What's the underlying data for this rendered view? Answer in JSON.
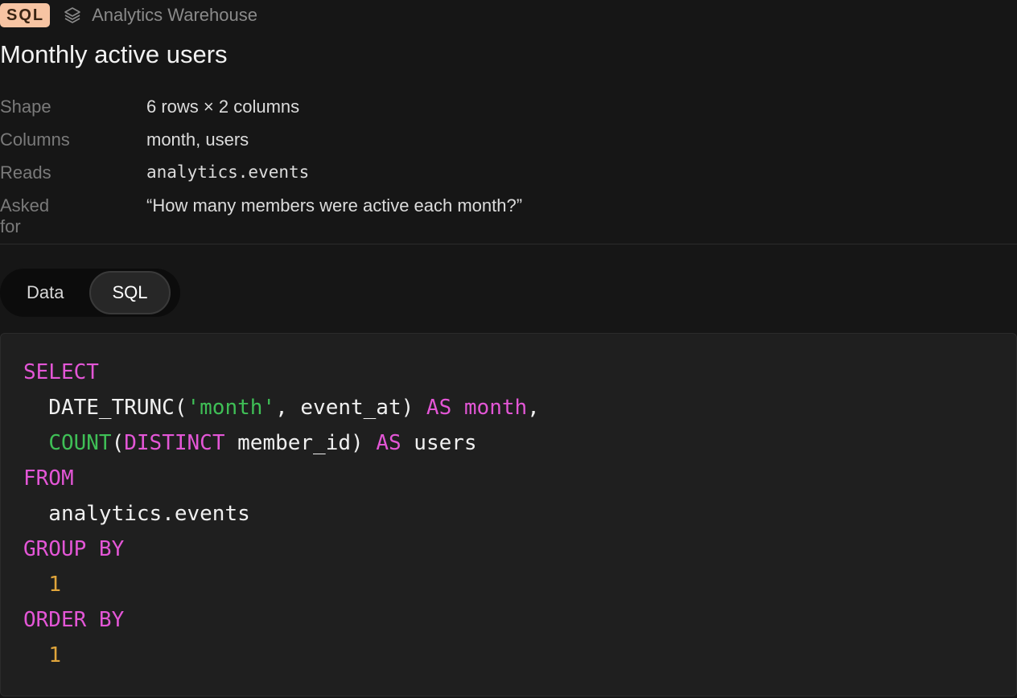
{
  "source": {
    "badge": "SQL",
    "icon": "layers-icon",
    "name": "Analytics Warehouse"
  },
  "title": "Monthly active users",
  "meta": [
    {
      "label": "Shape",
      "value": "6 rows × 2 columns"
    },
    {
      "label": "Columns",
      "value": "month, users"
    },
    {
      "label": "Reads",
      "value": "analytics.events"
    },
    {
      "label": "Asked for",
      "value": "“How many members were active each month?”"
    }
  ],
  "tabs": [
    {
      "label": "Data",
      "active": false
    },
    {
      "label": "SQL",
      "active": true
    }
  ],
  "colors": {
    "badge_bg": "#f7c4a3",
    "keyword": "#e356d6",
    "string": "#3fbf56",
    "function": "#3fbf56",
    "number": "#e0a53b",
    "background": "#161616",
    "code_background": "#1f1f1f"
  },
  "sql": {
    "lines": [
      [
        {
          "t": "SELECT",
          "c": "kw"
        }
      ],
      [
        {
          "t": "  DATE_TRUNC(",
          "c": "plain"
        },
        {
          "t": "'month'",
          "c": "str"
        },
        {
          "t": ", event_at) ",
          "c": "plain"
        },
        {
          "t": "AS",
          "c": "kw"
        },
        {
          "t": " ",
          "c": "plain"
        },
        {
          "t": "month",
          "c": "kw"
        },
        {
          "t": ",",
          "c": "plain"
        }
      ],
      [
        {
          "t": "  ",
          "c": "plain"
        },
        {
          "t": "COUNT",
          "c": "fn"
        },
        {
          "t": "(",
          "c": "plain"
        },
        {
          "t": "DISTINCT",
          "c": "kw"
        },
        {
          "t": " member_id) ",
          "c": "plain"
        },
        {
          "t": "AS",
          "c": "kw"
        },
        {
          "t": " users",
          "c": "plain"
        }
      ],
      [
        {
          "t": "FROM",
          "c": "kw"
        }
      ],
      [
        {
          "t": "  analytics.events",
          "c": "plain"
        }
      ],
      [
        {
          "t": "GROUP BY",
          "c": "kw"
        }
      ],
      [
        {
          "t": "  ",
          "c": "plain"
        },
        {
          "t": "1",
          "c": "num"
        }
      ],
      [
        {
          "t": "ORDER BY",
          "c": "kw"
        }
      ],
      [
        {
          "t": "  ",
          "c": "plain"
        },
        {
          "t": "1",
          "c": "num"
        }
      ]
    ]
  }
}
